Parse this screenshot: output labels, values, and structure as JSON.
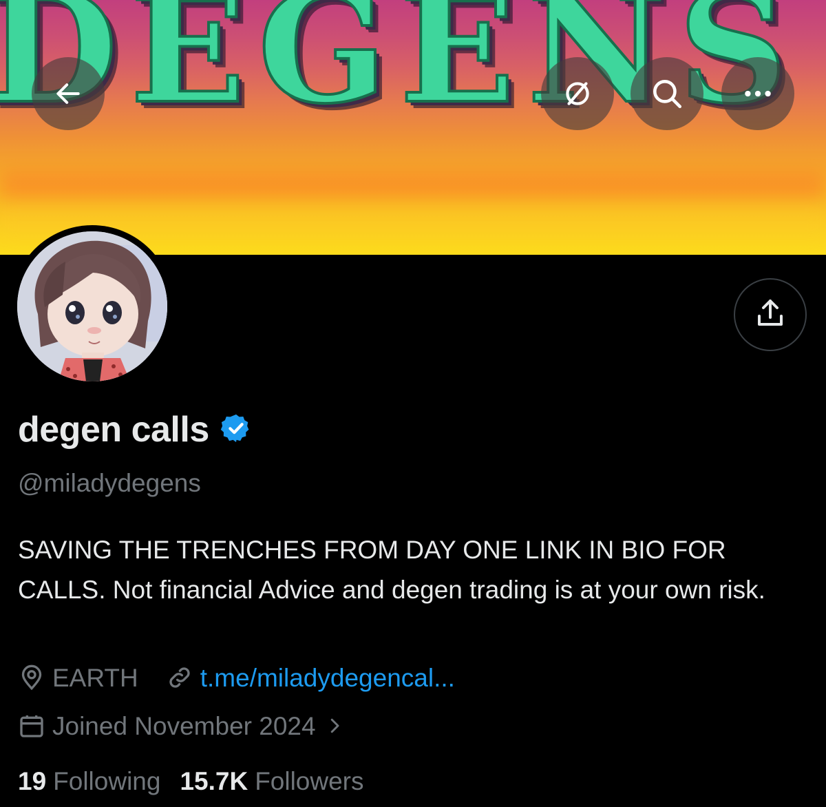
{
  "banner": {
    "word": "DEGENS"
  },
  "header_buttons": {
    "back": "back-arrow-icon",
    "hide": "eye-off-icon",
    "search": "search-icon",
    "more": "more-horizontal-icon"
  },
  "profile": {
    "display_name": "degen calls",
    "verified": true,
    "verified_color": "#1d9bf0",
    "handle": "@miladydegens",
    "bio": "SAVING THE TRENCHES FROM DAY ONE LINK IN BIO FOR CALLS. Not financial Advice and degen trading is at your own risk.",
    "location": "EARTH",
    "link": "t.me/miladydegencal...",
    "joined": "Joined November 2024",
    "following_count": "19",
    "following_label": "Following",
    "followers_count": "15.7K",
    "followers_label": "Followers"
  },
  "colors": {
    "background": "#000000",
    "text_primary": "#e7e9ea",
    "text_secondary": "#71767b",
    "accent": "#1d9bf0"
  }
}
